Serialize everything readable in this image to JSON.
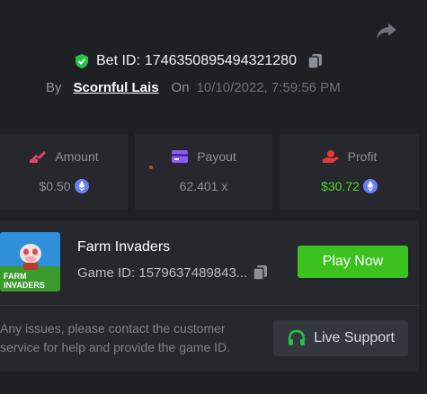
{
  "bet": {
    "label": "Bet ID:",
    "id": "1746350895494321280",
    "by_label": "By",
    "username": "Scornful Lais",
    "on_label": "On",
    "timestamp": "10/10/2022, 7:59:56 PM"
  },
  "stats": [
    {
      "label": "Amount",
      "value": "$0.50",
      "icon": "amount-icon"
    },
    {
      "label": "Payout",
      "value": "62.401 x",
      "icon": "payout-card-icon"
    },
    {
      "label": "Profit",
      "value": "$30.72",
      "icon": "profit-hand-icon"
    }
  ],
  "game": {
    "title": "Farm Invaders",
    "id_text": "Game ID: 1579637489843...",
    "thumb_line1": "FARM",
    "thumb_line2": "INVADERS",
    "play_label": "Play Now"
  },
  "support": {
    "text": "Any issues, please contact the customer service for help and provide the game ID.",
    "button_label": "Live Support"
  },
  "colors": {
    "accent_green": "#3cc21f",
    "profit_green": "#4fd62a",
    "icon_pink": "#e0436b",
    "icon_purple": "#8b5cf6",
    "icon_red": "#e53935",
    "coin_blue": "#6a7ff5"
  }
}
